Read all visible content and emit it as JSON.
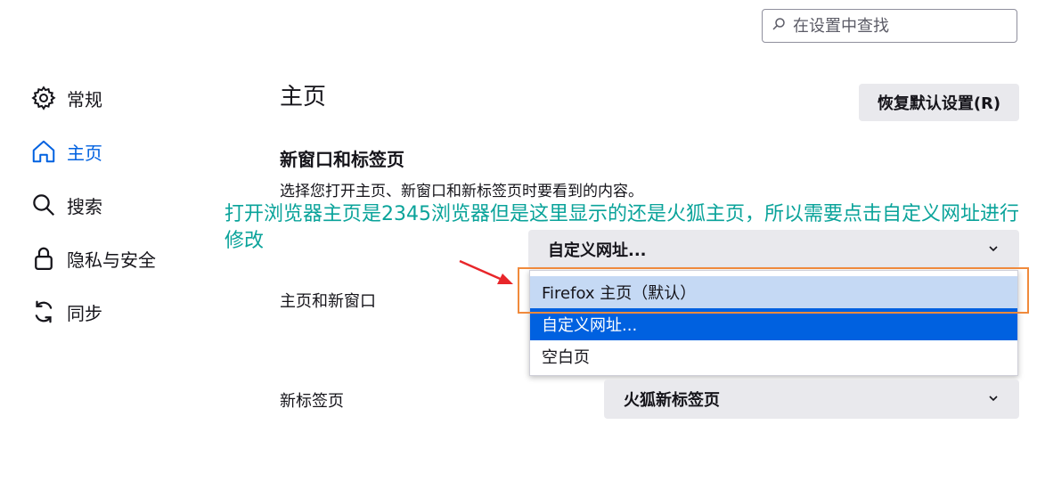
{
  "search": {
    "placeholder": "在设置中查找"
  },
  "sidebar": {
    "items": [
      {
        "label": "常规",
        "icon": "gear-icon"
      },
      {
        "label": "主页",
        "icon": "home-icon"
      },
      {
        "label": "搜索",
        "icon": "search-icon"
      },
      {
        "label": "隐私与安全",
        "icon": "lock-icon"
      },
      {
        "label": "同步",
        "icon": "sync-icon"
      }
    ],
    "active_index": 1
  },
  "main": {
    "title": "主页",
    "restore_button": "恢复默认设置(R)",
    "section": {
      "title": "新窗口和标签页",
      "description": "选择您打开主页、新窗口和新标签页时要看到的内容。"
    },
    "homepage": {
      "label": "主页和新窗口",
      "selected": "自定义网址..."
    },
    "homepage_options": [
      {
        "label": "Firefox 主页（默认）",
        "state": "hover"
      },
      {
        "label": "自定义网址...",
        "state": "selected"
      },
      {
        "label": "空白页",
        "state": "normal"
      }
    ],
    "newtab": {
      "label": "新标签页",
      "selected": "火狐新标签页"
    }
  },
  "annotation": {
    "text": "打开浏览器主页是2345浏览器但是这里显示的还是火狐主页，所以需要点击自定义网址进行修改",
    "text_color": "#0aa39a",
    "box_color": "#f08a3c",
    "arrow_color": "#e8262a"
  },
  "colors": {
    "accent": "#0061e0",
    "hover": "#c5d9f4",
    "button_bg": "#e9e9ed"
  }
}
